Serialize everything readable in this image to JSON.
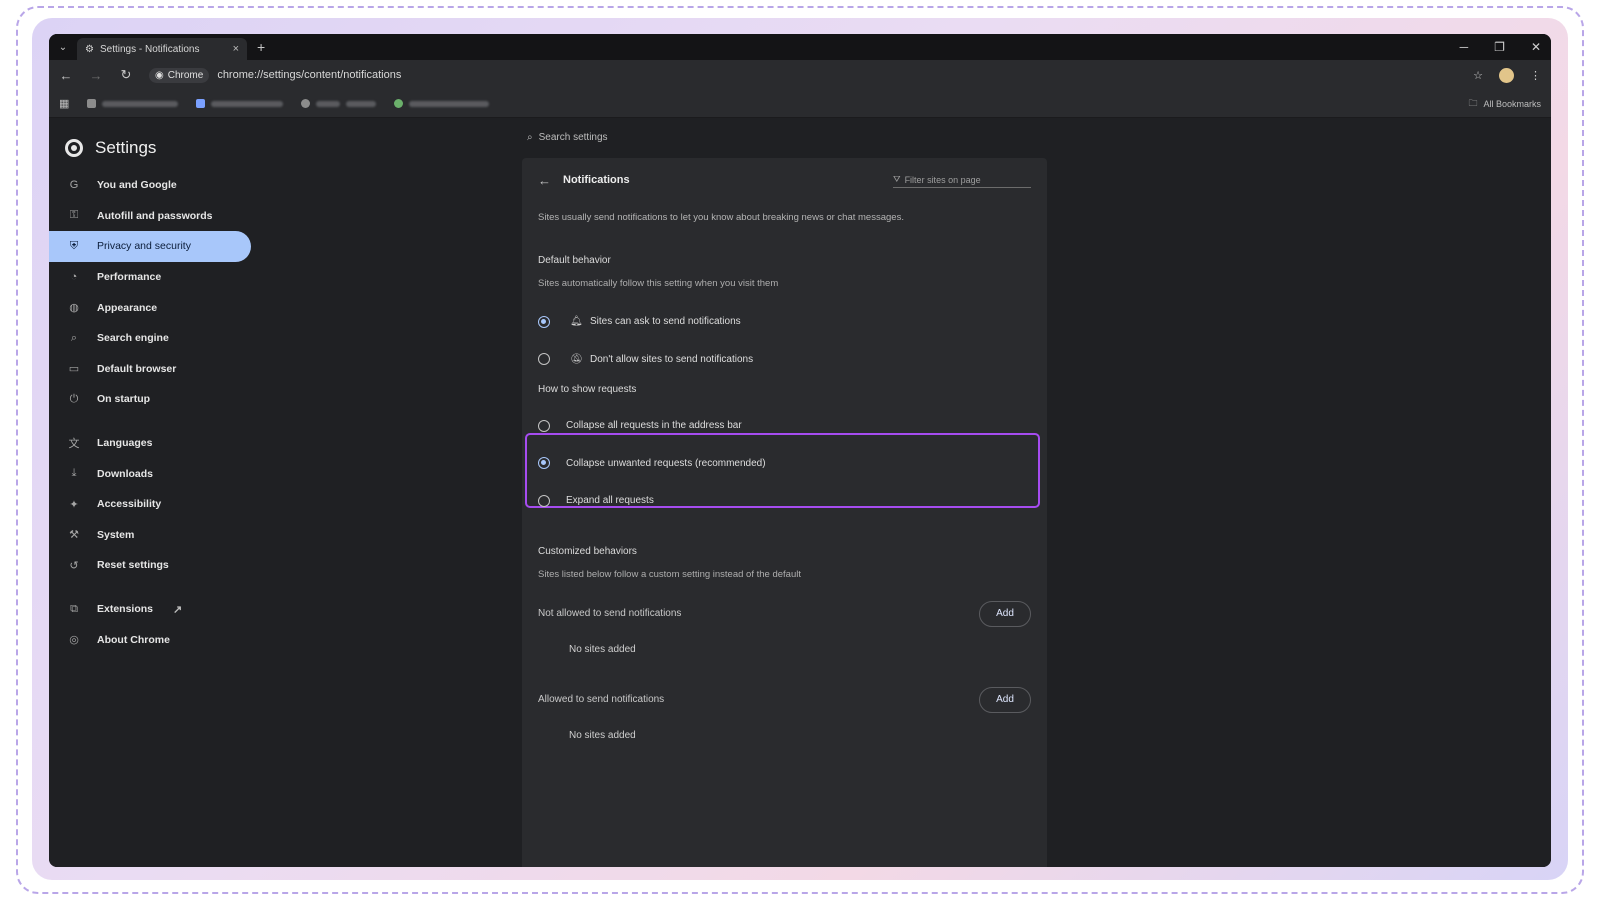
{
  "browser": {
    "tab_title": "Settings - Notifications",
    "tab_close": "×",
    "new_tab": "+",
    "omnibox_chip": "Chrome",
    "url": "chrome://settings/content/notifications",
    "all_bookmarks": "All Bookmarks",
    "win_minimize": "─",
    "win_restore": "❐",
    "win_close": "✕"
  },
  "settings": {
    "title": "Settings",
    "search_placeholder": "Search settings",
    "nav": [
      {
        "label": "You and Google",
        "icon": "google-icon"
      },
      {
        "label": "Autofill and passwords",
        "icon": "key-icon"
      },
      {
        "label": "Privacy and security",
        "icon": "shield-icon",
        "active": true
      },
      {
        "label": "Performance",
        "icon": "speedometer-icon"
      },
      {
        "label": "Appearance",
        "icon": "palette-icon"
      },
      {
        "label": "Search engine",
        "icon": "search-icon"
      },
      {
        "label": "Default browser",
        "icon": "browser-window-icon"
      },
      {
        "label": "On startup",
        "icon": "power-icon"
      },
      {
        "label": "Languages",
        "icon": "translate-icon"
      },
      {
        "label": "Downloads",
        "icon": "download-icon"
      },
      {
        "label": "Accessibility",
        "icon": "accessibility-icon"
      },
      {
        "label": "System",
        "icon": "wrench-icon"
      },
      {
        "label": "Reset settings",
        "icon": "reset-icon"
      },
      {
        "label": "Extensions",
        "icon": "puzzle-icon"
      },
      {
        "label": "About Chrome",
        "icon": "chrome-icon"
      }
    ]
  },
  "notifications": {
    "title": "Notifications",
    "filter_placeholder": "Filter sites on page",
    "description": "Sites usually send notifications to let you know about breaking news or chat messages.",
    "default_behavior": {
      "title": "Default behavior",
      "subtitle": "Sites automatically follow this setting when you visit them",
      "options": [
        {
          "label": "Sites can ask to send notifications",
          "checked": true
        },
        {
          "label": "Don't allow sites to send notifications",
          "checked": false
        }
      ]
    },
    "show_requests": {
      "title": "How to show requests",
      "options": [
        {
          "label": "Collapse all requests in the address bar",
          "checked": false
        },
        {
          "label": "Collapse unwanted requests (recommended)",
          "checked": true
        },
        {
          "label": "Expand all requests",
          "checked": false
        }
      ]
    },
    "customized": {
      "title": "Customized behaviors",
      "subtitle": "Sites listed below follow a custom setting instead of the default",
      "not_allowed_label": "Not allowed to send notifications",
      "allowed_label": "Allowed to send notifications",
      "add_label": "Add",
      "empty_label": "No sites added"
    }
  },
  "colors": {
    "accent": "#a8c7fa",
    "highlight": "#a64cf0"
  }
}
